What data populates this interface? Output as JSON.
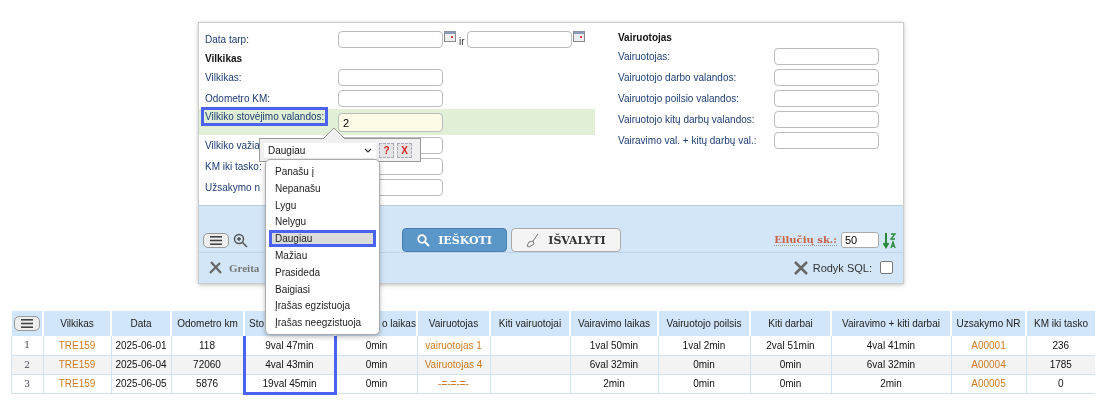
{
  "filters": {
    "date_range": {
      "label": "Data tarp:",
      "separator": "ir"
    },
    "truck_section": {
      "title": "Vilkikas",
      "fields": [
        {
          "label": "Vilkikas:",
          "active": false
        },
        {
          "label": "Odometro KM:",
          "active": false
        },
        {
          "label": "Vilkiko stovėjimo valandos:",
          "value": "2",
          "active": true,
          "highlighted": true
        },
        {
          "label": "Vilkiko važia",
          "active": false
        },
        {
          "label": "KM iki tasko:",
          "active": false
        },
        {
          "label": "Užsakymo n",
          "active": false
        }
      ]
    },
    "driver_section": {
      "title": "Vairuotojas",
      "fields": [
        {
          "label": "Vairuotojas:"
        },
        {
          "label": "Vairuotojo darbo valandos:"
        },
        {
          "label": "Vairuotojo poilsio valandos:"
        },
        {
          "label": "Vairuotojo kitų darbų valandos:"
        },
        {
          "label": "Vairavimo val. + kitų darbų val.:"
        }
      ]
    }
  },
  "operator_popup": {
    "value": "Daugiau",
    "help": "?",
    "clear": "X",
    "options": [
      {
        "label": "Panašu į",
        "selected": false
      },
      {
        "label": "Nepanašu",
        "selected": false
      },
      {
        "label": "Lygu",
        "selected": false
      },
      {
        "label": "Nelygu",
        "selected": false
      },
      {
        "label": "Daugiau",
        "selected": true
      },
      {
        "label": "Mažiau",
        "selected": false
      },
      {
        "label": "Prasideda",
        "selected": false
      },
      {
        "label": "Baigiasi",
        "selected": false
      },
      {
        "label": "Įrašas egzistuoja",
        "selected": false
      },
      {
        "label": "Įrašas neegzistuoja",
        "selected": false
      }
    ]
  },
  "toolbar": {
    "search_button": "IEŠKOTI",
    "clear_button": "IŠVALYTI",
    "rows_per_page": {
      "label": "Eilučių sk.:",
      "value": "50"
    },
    "quick": "Greita",
    "show_sql": {
      "label": "Rodyk SQL:",
      "checked": false
    }
  },
  "table": {
    "columns": [
      {
        "label": "Vilkikas",
        "kind": "link"
      },
      {
        "label": "Data",
        "kind": "text"
      },
      {
        "label": "Odometro km",
        "kind": "text"
      },
      {
        "label": "Sto",
        "kind": "text",
        "highlighted": true
      },
      {
        "label": "o laikas",
        "kind": "text"
      },
      {
        "label": "Vairuotojas",
        "kind": "link"
      },
      {
        "label": "Kiti vairuotojai",
        "kind": "text"
      },
      {
        "label": "Vairavimo laikas",
        "kind": "text"
      },
      {
        "label": "Vairuotojo poilsis",
        "kind": "text"
      },
      {
        "label": "Kiti darbai",
        "kind": "text"
      },
      {
        "label": "Vairavimo + kiti darbai",
        "kind": "text"
      },
      {
        "label": "Uzsakymo NR",
        "kind": "link"
      },
      {
        "label": "KM iki tasko",
        "kind": "text"
      }
    ],
    "rows": [
      {
        "number": "1",
        "cells": [
          "TRE159",
          "2025-06-01",
          "118",
          "9val 47min",
          "0min",
          "vairuotojas 1",
          null,
          "1val 50min",
          "1val 2min",
          "2val 51min",
          "4val 41min",
          "A00001",
          "236"
        ]
      },
      {
        "number": "2",
        "cells": [
          "TRE159",
          "2025-06-04",
          "72060",
          "4val 43min",
          "0min",
          "Vairuotojas 4",
          null,
          "6val 32min",
          "0min",
          "0min",
          "6val 32min",
          "A00004",
          "1785"
        ]
      },
      {
        "number": "3",
        "cells": [
          "TRE159",
          "2025-06-05",
          "5876",
          "19val 45min",
          "0min",
          "-=-=-=-",
          null,
          "2min",
          "0min",
          "0min",
          "2min",
          "A00005",
          "0"
        ]
      }
    ]
  }
}
